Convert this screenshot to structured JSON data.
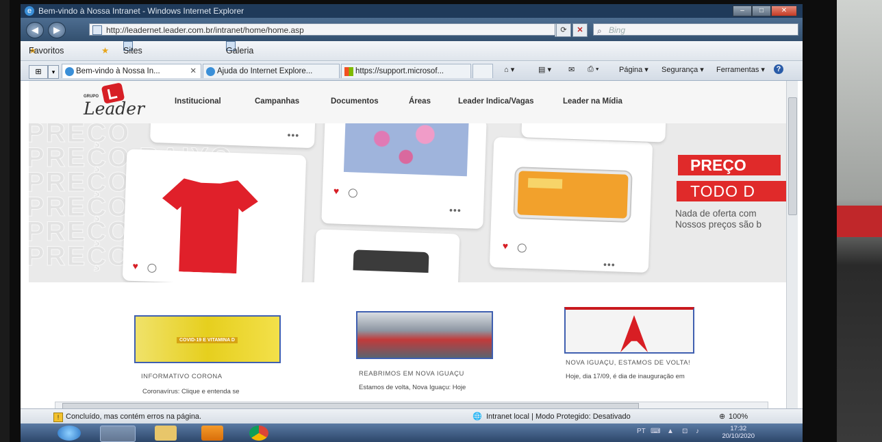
{
  "window": {
    "title": "Bem-vindo à Nossa Intranet - Windows Internet Explorer"
  },
  "address_bar": {
    "url": "http://leadernet.leader.com.br/intranet/home/home.asp",
    "search_placeholder": "Bing"
  },
  "favorites_bar": {
    "favorites_label": "Favoritos",
    "items": [
      "Sites Sugeridos ▾",
      "Galeria do Web Slice ▾"
    ]
  },
  "tabs": [
    {
      "label": "Bem-vindo à Nossa In...",
      "active": true
    },
    {
      "label": "Ajuda do Internet Explore...",
      "active": false
    },
    {
      "label": "https://support.microsof...",
      "active": false
    }
  ],
  "command_bar": {
    "page_label": "Página ▾",
    "safety_label": "Segurança ▾",
    "tools_label": "Ferramentas ▾",
    "help_label": "?"
  },
  "site": {
    "logo_grupo": "GRUPO",
    "logo_name": "Leader",
    "nav": [
      "Institucional",
      "Campanhas",
      "Documentos",
      "Áreas",
      "Leader Indica/Vagas",
      "Leader na Mídia"
    ]
  },
  "banner": {
    "bg_words": [
      "PREÇO",
      "PREÇO BAIXO",
      "PREÇO",
      "PREÇO",
      "PREÇO",
      "PREÇO"
    ],
    "promo_title": "PREÇO",
    "promo_sub": "TODO D",
    "promo_line1": "Nada de oferta com",
    "promo_line2": "Nossos preços são b"
  },
  "news": [
    {
      "image_text": "COVID-19 E VITAMINA D",
      "title": "INFORMATIVO CORONA",
      "body": "Coronavírus:   Clique   e   entenda   se"
    },
    {
      "title": "REABRIMOS EM NOVA IGUAÇU",
      "body": "Estamos de volta, Nova Iguaçu: Hoje"
    },
    {
      "title": "NOVA IGUAÇU, ESTAMOS DE VOLTA!",
      "body": "Hoje, dia 17/09, é dia de inauguração em"
    }
  ],
  "status": {
    "message": "Concluído, mas contém erros na página.",
    "zone": "Intranet local | Modo Protegido: Desativado",
    "zoom": "100%"
  },
  "taskbar": {
    "language": "PT",
    "time": "17:32",
    "date": "20/10/2020"
  }
}
